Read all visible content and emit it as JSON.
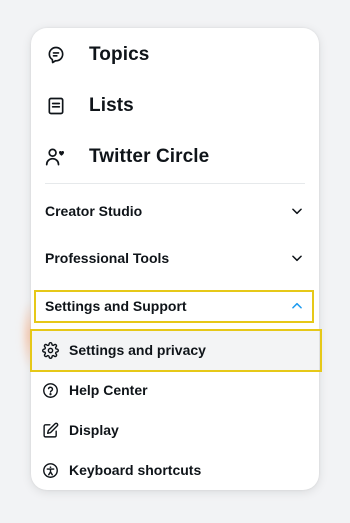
{
  "menu": {
    "items": [
      {
        "label": "Topics",
        "icon": "topics-icon"
      },
      {
        "label": "Lists",
        "icon": "lists-icon"
      },
      {
        "label": "Twitter Circle",
        "icon": "twitter-circle-icon"
      }
    ],
    "sections": [
      {
        "label": "Creator Studio",
        "state": "collapsed",
        "chevron": "chevron-down-icon"
      },
      {
        "label": "Professional Tools",
        "state": "collapsed",
        "chevron": "chevron-down-icon"
      },
      {
        "label": "Settings and Support",
        "state": "expanded",
        "chevron": "chevron-up-icon"
      }
    ],
    "settings_support_items": [
      {
        "label": "Settings and privacy",
        "icon": "gear-icon",
        "highlighted": true
      },
      {
        "label": "Help Center",
        "icon": "help-circle-icon"
      },
      {
        "label": "Display",
        "icon": "display-edit-icon"
      },
      {
        "label": "Keyboard shortcuts",
        "icon": "accessibility-icon"
      }
    ]
  },
  "colors": {
    "text": "#0f1419",
    "highlight_border": "#e6c818",
    "chevron_up_accent": "#1d9bf0",
    "background": "#f2f3f5",
    "panel": "#ffffff"
  }
}
